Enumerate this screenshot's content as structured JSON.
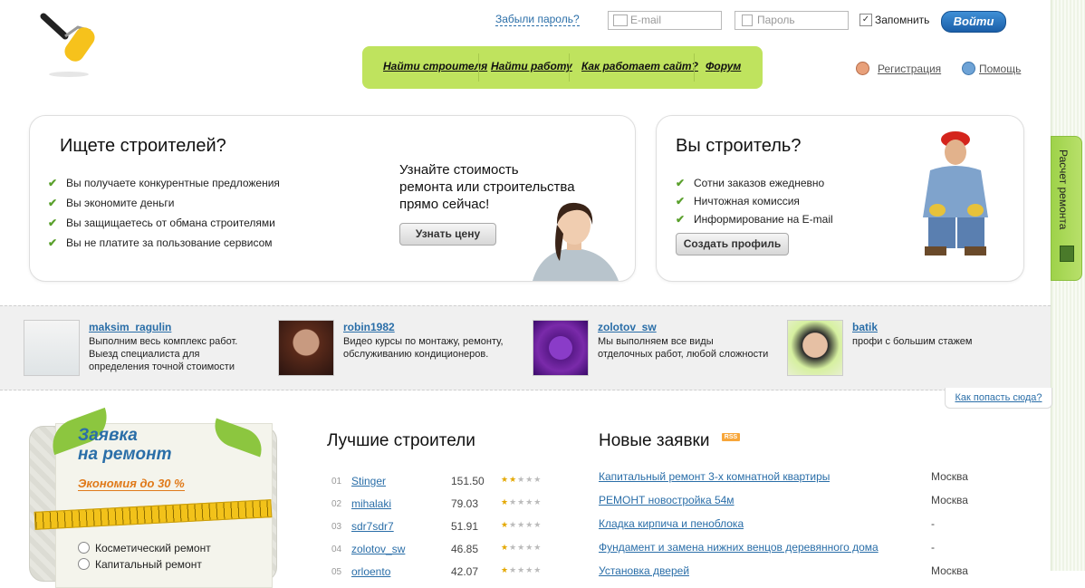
{
  "header": {
    "forgot_password": "Забыли пароль?",
    "email_placeholder": "E-mail",
    "password_placeholder": "Пароль",
    "remember_label": "Запомнить",
    "remember_checked": true,
    "login_button": "Войти",
    "registration": "Регистрация",
    "help": "Помощь"
  },
  "nav": {
    "items": [
      {
        "label": "Найти строителя"
      },
      {
        "label": "Найти работу"
      },
      {
        "label": "Как работает сайт?"
      },
      {
        "label": "Форум"
      }
    ]
  },
  "side_tab": {
    "label": "Расчет ремонта"
  },
  "customers_box": {
    "title": "Ищете строителей?",
    "bullets": [
      "Вы получаете конкурентные предложения",
      "Вы экономите деньги",
      "Вы защищаетесь от обмана строителями",
      "Вы не платите за пользование сервисом"
    ],
    "promo_lines": [
      "Узнайте стоимость",
      "ремонта или строительства",
      "прямо сейчас!"
    ],
    "button": "Узнать цену"
  },
  "builders_box": {
    "title": "Вы строитель?",
    "bullets": [
      "Сотни заказов ежедневно",
      "Ничтожная комиссия",
      "Информирование на E-mail"
    ],
    "button": "Создать профиль"
  },
  "featured": [
    {
      "name": "maksim_ragulin",
      "desc": "Выполним весь комплекс работ. Выезд специалиста для определения точной стоимости"
    },
    {
      "name": "robin1982",
      "desc": "Видео курсы по монтажу, ремонту, обслуживанию кондиционеров."
    },
    {
      "name": "zolotov_sw",
      "desc": "Мы выполняем все виды отделочных работ, любой сложности"
    },
    {
      "name": "batik",
      "desc": "профи с большим стажем"
    }
  ],
  "how_to_get_here": "Как попасть сюда?",
  "repair_card": {
    "title_line1": "Заявка",
    "title_line2": "на ремонт",
    "subtitle": "Экономия до 30 %",
    "options": [
      "Косметический ремонт",
      "Капитальный ремонт"
    ]
  },
  "best_builders": {
    "title": "Лучшие строители",
    "rows": [
      {
        "num": "01",
        "name": "Stinger",
        "score": "151.50",
        "rating": 2
      },
      {
        "num": "02",
        "name": "mihalaki",
        "score": "79.03",
        "rating": 1
      },
      {
        "num": "03",
        "name": "sdr7sdr7",
        "score": "51.91",
        "rating": 1
      },
      {
        "num": "04",
        "name": "zolotov_sw",
        "score": "46.85",
        "rating": 1
      },
      {
        "num": "05",
        "name": "orloento",
        "score": "42.07",
        "rating": 1
      }
    ]
  },
  "new_orders": {
    "title": "Новые заявки",
    "rss": "RSS",
    "rows": [
      {
        "title": "Капитальный ремонт 3-х комнатной квартиры",
        "city": "Москва"
      },
      {
        "title": "РЕМОНТ новостройка 54м",
        "city": "Москва"
      },
      {
        "title": "Кладка кирпича и пеноблока",
        "city": "-"
      },
      {
        "title": "Фундамент и замена нижних венцов деревянного дома",
        "city": "-"
      },
      {
        "title": "Установка дверей",
        "city": "Москва"
      }
    ]
  },
  "colors": {
    "accent": "#2a6ea8",
    "nav_green": "#bfe35e",
    "check_green": "#5aa02c",
    "orange": "#e07a1a"
  }
}
